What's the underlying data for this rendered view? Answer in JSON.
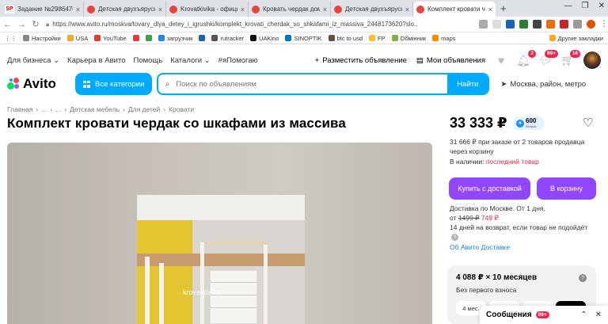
{
  "browser": {
    "tabs": [
      {
        "title": "Задание №2986470 - п",
        "fav": "sp-favicon",
        "color": "#ffffff"
      },
      {
        "title": "Детская двухъярусная к",
        "fav": "avito-favicon",
        "color": "#e8463b"
      },
      {
        "title": "Krovatkivika - официал",
        "fav": "avito-favicon",
        "color": "#e8463b"
      },
      {
        "title": "Кровать чердак домик",
        "fav": "avito-favicon",
        "color": "#e8463b"
      },
      {
        "title": "Детская двухъярусная к",
        "fav": "avito-favicon",
        "color": "#e8463b"
      },
      {
        "title": "Комплект кровати черда",
        "fav": "avito-favicon",
        "color": "#e8463b"
      }
    ],
    "tab_sp_label": "SP",
    "url": "https://www.avito.ru/moskva/tovary_dlya_detey_i_igrushki/komplekt_krovati_cherdak_so_shkafami_iz_massiva_2448173620?slo...",
    "bookmarks": [
      "Настройки",
      "USA",
      "YouTube",
      "загрузчик",
      "rutracker",
      "UAKino",
      "SINOPTIK",
      "btc to usd",
      "FP",
      "Обмінник",
      "maps"
    ],
    "bookmarks_right": "Другие закладки"
  },
  "avito": {
    "topnav": {
      "business": "Для бизнеса",
      "career": "Карьера в Авито",
      "help": "Помощь",
      "catalogs": "Каталоги",
      "hashtag": "#яПомогаю",
      "post_ad": "Разместить объявление",
      "my_ads": "Мои объявления",
      "badges": {
        "notifications": "2",
        "messages": "99+",
        "cart": "16"
      }
    },
    "logo": "Avito",
    "categories_button": "Все категории",
    "search_placeholder": "Поиск по объявлениям",
    "search_button": "Найти",
    "location": "Москва, район, метро",
    "breadcrumbs": [
      "Главная",
      "...",
      "...",
      "Детская мебель",
      "Для детей",
      "Кровати"
    ],
    "title": "Комплект кровати чердак со шкафами из массива",
    "watermark": "krovatkivika",
    "price": "33 333 ₽",
    "points": {
      "value": "600",
      "label": "бонусы"
    },
    "order_note": "31 666 ₽ при заказе от 2 товаров продавца через корзину",
    "availability_label": "В наличии:",
    "availability_value": "последний товар",
    "buy_button": "Купить с доставкой",
    "cart_button": "В корзину",
    "delivery_line1": "Доставка по Москве. От 1 дня,",
    "delivery_from": "от",
    "delivery_old": "1499 ₽",
    "delivery_new": "749 ₽",
    "return_note": "14 дней на возврат, если товар не подойдёт",
    "about_delivery": "Об Авито Доставке",
    "installment": {
      "amount": "4 088 ₽ × 10 месяцев",
      "subtitle": "Без первого взноса",
      "chips": [
        "4 мес.",
        "",
        "",
        ""
      ]
    },
    "messages": {
      "label": "Сообщения",
      "badge": "99+"
    }
  },
  "colors": {
    "accent": "#00aaff",
    "purple": "#9147ff",
    "red": "#f0244d",
    "link": "#0a8ae6"
  }
}
